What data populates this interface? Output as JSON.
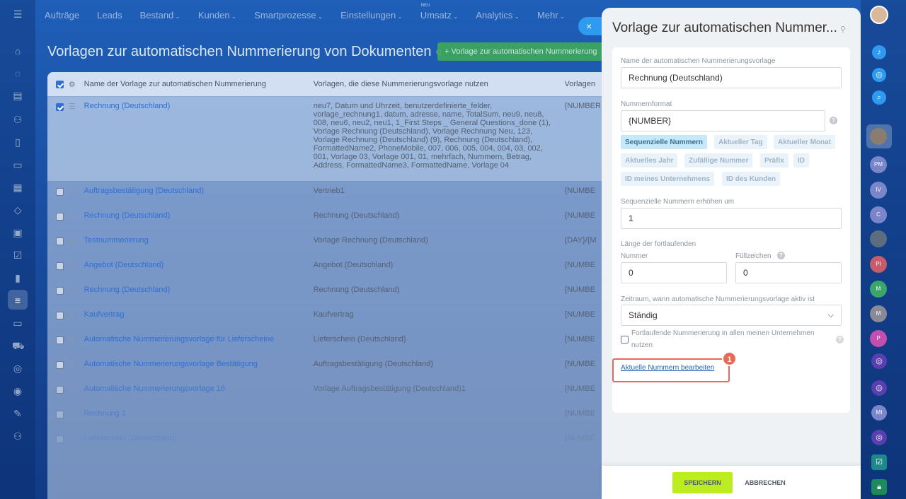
{
  "topnav": {
    "items": [
      {
        "label": "Aufträge",
        "chevron": false
      },
      {
        "label": "Leads",
        "chevron": false
      },
      {
        "label": "Bestand",
        "chevron": true
      },
      {
        "label": "Kunden",
        "chevron": true
      },
      {
        "label": "Smartprozesse",
        "chevron": true
      },
      {
        "label": "Einstellungen",
        "chevron": true
      },
      {
        "label": "Umsatz",
        "chevron": true,
        "badge": "NEU"
      },
      {
        "label": "Analytics",
        "chevron": true
      },
      {
        "label": "Mehr",
        "chevron": true
      }
    ]
  },
  "page": {
    "title": "Vorlagen zur automatischen Nummerierung von Dokumenten",
    "add_button": "+ Vorlage zur automatischen Nummerierung"
  },
  "table": {
    "headers": {
      "name": "Name der Vorlage zur automatischen Nummerierung",
      "templates": "Vorlagen, die diese Nummerierungsvorlage nutzen",
      "format": "Vorlagen"
    },
    "rows": [
      {
        "name": "Rechnung (Deutschland)",
        "templates": "neu7, Datum und Uhrzeit, benutzerdefinierte_felder, vorlage_rechnung1, datum, adresse, name, TotalSum, neu9, neu8, 008, neu6, neu2, neu1, 1_First Steps _ General Questions_done (1), Vorlage Rechnung (Deutschland), Vorlage Rechnung Neu, 123, Vorlage Rechnung (Deutschland) (9), Rechnung (Deutschland), FormattedName2, PhoneMobile, 007, 006, 005, 004, 004, 03, 002, 001, Vorlage 03, Vorlage 001, 01, mehrfach, Nummern, Betrag, Address, FormattedName3, FormattedName, Vorlage 04",
        "format": "{NUMBER",
        "checked": true
      },
      {
        "name": "Auftragsbestätigung (Deutschland)",
        "templates": "Vertrieb1",
        "format": "{NUMBE",
        "checked": false
      },
      {
        "name": "Rechnung (Deutschland)",
        "templates": "Rechnung (Deutschland)",
        "format": "{NUMBE",
        "checked": false
      },
      {
        "name": "Testnummerierung",
        "templates": "Vorlage Rechnung (Deutschland)",
        "format": "{DAY}/{M",
        "checked": false
      },
      {
        "name": "Angebot (Deutschland)",
        "templates": "Angebot (Deutschland)",
        "format": "{NUMBE",
        "checked": false
      },
      {
        "name": "Rechnung (Deutschland)",
        "templates": "Rechnung (Deutschland)",
        "format": "{NUMBE",
        "checked": false
      },
      {
        "name": "Kaufvertrag",
        "templates": "Kaufvertrag",
        "format": "{NUMBE",
        "checked": false
      },
      {
        "name": "Automatische Nummerierungsvorlage für Lieferscheine",
        "templates": "Lieferschein (Deutschland)",
        "format": "{NUMBE",
        "checked": false
      },
      {
        "name": "Automatische Nummerierungsvorlage Bestätigung",
        "templates": "Auftragsbestätigung (Deutschland)",
        "format": "{NUMBE",
        "checked": false
      },
      {
        "name": "Automatische Nummerierungsvorlage 16",
        "templates": "Vorlage Auftragsbestätigung (Deutschland)1",
        "format": "{NUMBE",
        "checked": false
      },
      {
        "name": "Rechnung 1",
        "templates": "",
        "format": "{NUMBE",
        "checked": false
      },
      {
        "name": "Lieferschein (Deutschland)",
        "templates": "",
        "format": "{NUMBE",
        "checked": false
      }
    ]
  },
  "panel": {
    "title": "Vorlage zur automatischen Nummer...",
    "close_icon": "×",
    "name_label": "Name der automatischen Nummerierungsvorlage",
    "name_value": "Rechnung (Deutschland)",
    "format_label": "Nummernformat",
    "format_value": "{NUMBER}",
    "tags": [
      "Sequenzielle Nummern",
      "Aktueller Tag",
      "Aktueller Monat",
      "Aktuelles Jahr",
      "Zufällige Nummer",
      "Präfix",
      "ID",
      "ID meines Unternehmens",
      "ID des Kunden"
    ],
    "step_label": "Sequenzielle Nummern erhöhen um",
    "step_value": "1",
    "length_label": "Länge der fortlaufenden",
    "length_sub": "Nummer",
    "fill_label": "Füllzeichen",
    "length_value": "0",
    "fill_value": "0",
    "period_label": "Zeitraum, wann automatische Nummerierungsvorlage aktiv ist",
    "period_value": "Ständig",
    "checkbox_line1": "Fortlaufende Nummerierung in allen meinen Unternehmen",
    "checkbox_line2": "nutzen",
    "edit_link": "Aktuelle Nummern bearbeiten",
    "badge": "1",
    "save": "SPEICHERN",
    "cancel": "ABBRECHEN"
  },
  "rightbar": {
    "avatars": [
      {
        "initials": "",
        "color": "#8a7c6e"
      },
      {
        "initials": "PM",
        "color": "#7a86c9"
      },
      {
        "initials": "IV",
        "color": "#7a86c9"
      },
      {
        "initials": "C",
        "color": "#7a86c9"
      },
      {
        "initials": "",
        "color": "#5d6d80"
      },
      {
        "initials": "PI",
        "color": "#c75b6a"
      },
      {
        "initials": "M",
        "color": "#3aa66a"
      },
      {
        "initials": "M",
        "color": "#8a8a95"
      },
      {
        "initials": "P",
        "color": "#c24fb0"
      }
    ]
  }
}
